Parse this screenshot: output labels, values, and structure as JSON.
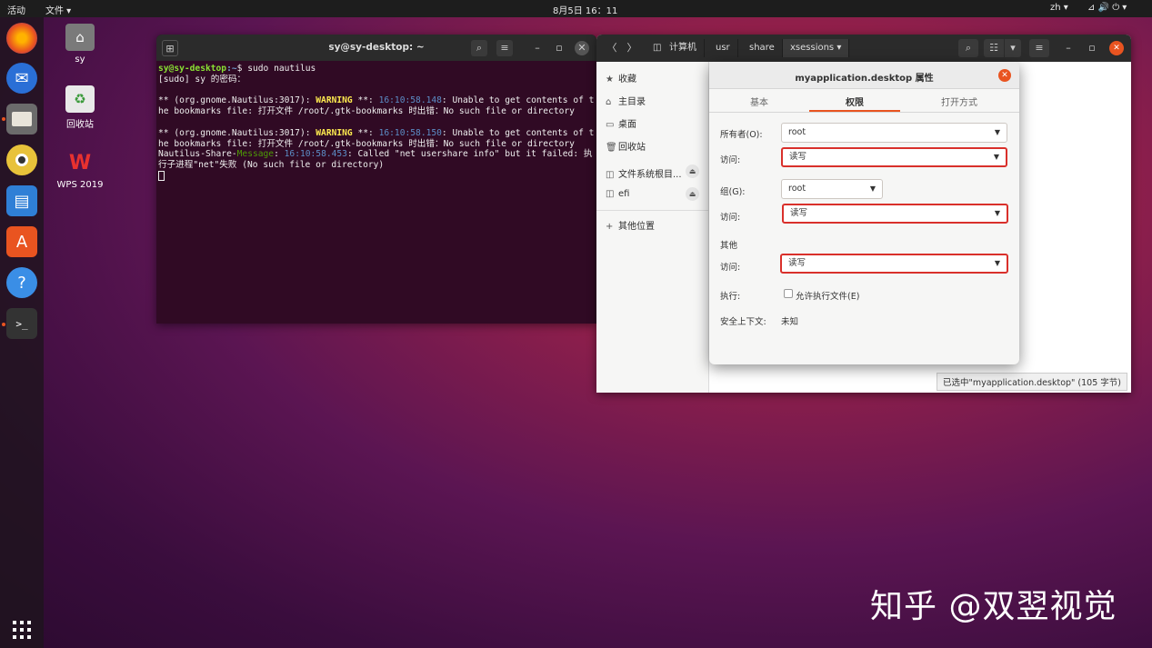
{
  "topbar": {
    "activities": "活动",
    "app_menu": "文件 ▾",
    "clock": "8月5日 16：11",
    "lang": "zh ▾",
    "status_icons": "⊿ 🔊 ⏻ ▾"
  },
  "desktop": {
    "icons": [
      {
        "label": "sy"
      },
      {
        "label": "回收站"
      },
      {
        "label": "WPS 2019"
      }
    ]
  },
  "terminal": {
    "title": "sy@sy-desktop: ~",
    "prompt_user": "sy@sy-desktop",
    "prompt_path": ":~",
    "command": "$ sudo nautilus",
    "line_sudo": "[sudo] sy 的密码：",
    "warn1_pre": "** (org.gnome.Nautilus:3017): ",
    "warn_label": "WARNING",
    "warn_mid": " **: ",
    "warn1_time": "16:10:58.148",
    "warn1_msg": ": Unable to get contents of the bookmarks file: 打开文件 /root/.gtk-bookmarks 时出错：No such file or directory",
    "warn2_pre": "** (org.gnome.Nautilus:3017): ",
    "warn2_time": "16:10:58.150",
    "warn2_msg": ": Unable to get contents of the bookmarks file: 打开文件 /root/.gtk-bookmarks 时出错：No such file or directory",
    "share_pre": "Nautilus-Share-",
    "share_label": "Message",
    "share_sep": ": ",
    "share_time": "16:10:58.453",
    "share_msg": ": Called \"net usershare info\" but it failed: 执行子进程\"net\"失败 (No such file or directory)"
  },
  "files": {
    "breadcrumbs": [
      "计算机",
      "usr",
      "share",
      "xsessions"
    ],
    "sidebar": [
      {
        "icon": "★",
        "label": "收藏"
      },
      {
        "icon": "⌂",
        "label": "主目录"
      },
      {
        "icon": "▭",
        "label": "桌面"
      },
      {
        "icon": "🗑",
        "label": "回收站"
      },
      {
        "icon": "◫",
        "label": "文件系统根目..."
      },
      {
        "icon": "◫",
        "label": "efi"
      },
      {
        "icon": "+",
        "label": "其他位置"
      }
    ],
    "status": "已选中\"myapplication.desktop\" (105 字节)"
  },
  "dialog": {
    "title": "myapplication.desktop 属性",
    "tabs": [
      "基本",
      "权限",
      "打开方式"
    ],
    "owner_label": "所有者(O):",
    "owner_value": "root",
    "owner_access_label": "访问:",
    "owner_access_value": "读写",
    "group_label": "组(G):",
    "group_value": "root",
    "group_access_label": "访问:",
    "group_access_value": "读写",
    "others_label": "其他",
    "others_access_label": "访问:",
    "others_access_value": "读写",
    "exec_label": "执行:",
    "exec_checkbox_label": "允许执行文件(E)",
    "security_label": "安全上下文:",
    "security_value": "未知"
  },
  "watermark": "知乎 @双翌视觉",
  "colors": {
    "accent": "#e95420",
    "highlight": "#d9302b",
    "terminal_bg": "#300a24"
  }
}
